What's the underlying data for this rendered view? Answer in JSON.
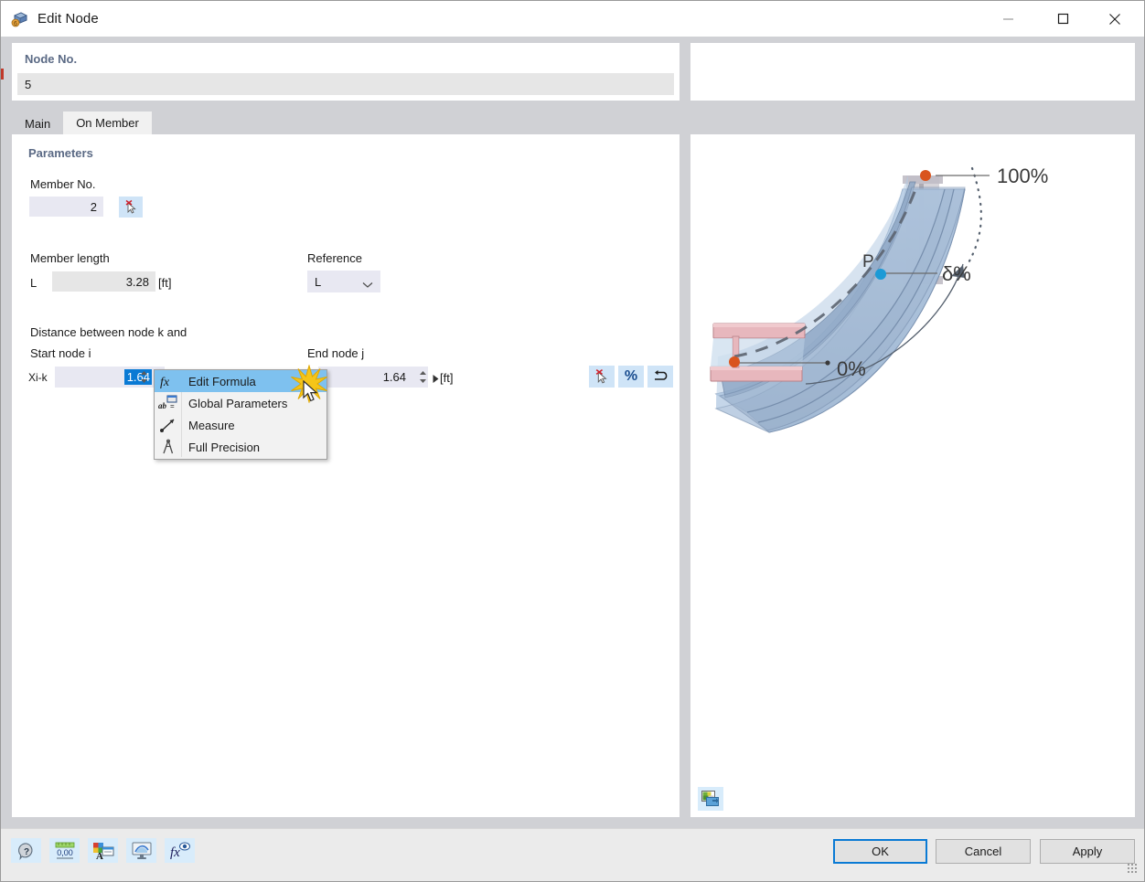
{
  "window": {
    "title": "Edit Node",
    "icon": "node-cube-icon",
    "minimize_label": "–",
    "maximize_label": "□",
    "close_label": "×"
  },
  "node": {
    "section_label": "Node No.",
    "value": "5"
  },
  "tabs": [
    {
      "label": "Main",
      "active": false
    },
    {
      "label": "On Member",
      "active": true
    }
  ],
  "parameters": {
    "title": "Parameters",
    "member_no": {
      "label": "Member No.",
      "value": "2",
      "pick_icon": "pick-select-icon"
    },
    "member_length": {
      "label": "Member length",
      "symbol": "L",
      "value": "3.28",
      "unit": "[ft]"
    },
    "reference": {
      "label": "Reference",
      "value": "L",
      "chevron_icon": "chevron-down-icon"
    },
    "distance": {
      "heading": "Distance between node k and",
      "start_node_label": "Start node i",
      "end_node_label": "End node j",
      "start": {
        "symbol": "Xi-k",
        "value": "1.64",
        "selected": true
      },
      "end": {
        "value": "1.64",
        "unit": "[ft]"
      },
      "tools": [
        {
          "name": "pick-select-icon",
          "label": ""
        },
        {
          "name": "percent-icon",
          "label": "%"
        },
        {
          "name": "reset-arrow-icon",
          "label": ""
        }
      ]
    }
  },
  "context_menu": {
    "items": [
      {
        "label": "Edit Formula",
        "icon": "fx-icon",
        "selected": true
      },
      {
        "label": "Global Parameters",
        "icon": "ab-equals-icon",
        "selected": false
      },
      {
        "label": "Measure",
        "icon": "measure-ruler-icon",
        "selected": false
      },
      {
        "label": "Full Precision",
        "icon": "compass-divider-icon",
        "selected": false
      }
    ]
  },
  "preview": {
    "labels": {
      "hundred_percent": "100%",
      "delta_percent": "δ%",
      "zero_percent": "0%",
      "point": "P"
    },
    "toggle_icon": "preview-image-toggle-icon",
    "colors": {
      "beam_fill": "#a8c0dc",
      "beam_light": "#c6d8ec",
      "flange": "#e8b8bc",
      "node_marker": "#d9541e",
      "point_marker": "#1b9ad6"
    }
  },
  "footer": {
    "tool_icons": [
      {
        "name": "help-question-icon"
      },
      {
        "name": "decimal-places-icon"
      },
      {
        "name": "display-properties-icon"
      },
      {
        "name": "visibility-icon"
      },
      {
        "name": "formula-eye-icon"
      }
    ],
    "buttons": [
      {
        "name": "ok-button",
        "label": "OK",
        "primary": true
      },
      {
        "name": "cancel-button",
        "label": "Cancel",
        "primary": false
      },
      {
        "name": "apply-button",
        "label": "Apply",
        "primary": false
      }
    ]
  },
  "colors": {
    "accent": "#0a7ad4",
    "header_text": "#5b6a85",
    "dialog_bg": "#d0d1d5",
    "field_bg": "#e8e8f2",
    "readonly_bg": "#e6e6e6",
    "icon_btn_bg": "#cfe4f7",
    "menu_highlight": "#7ec1ef"
  }
}
